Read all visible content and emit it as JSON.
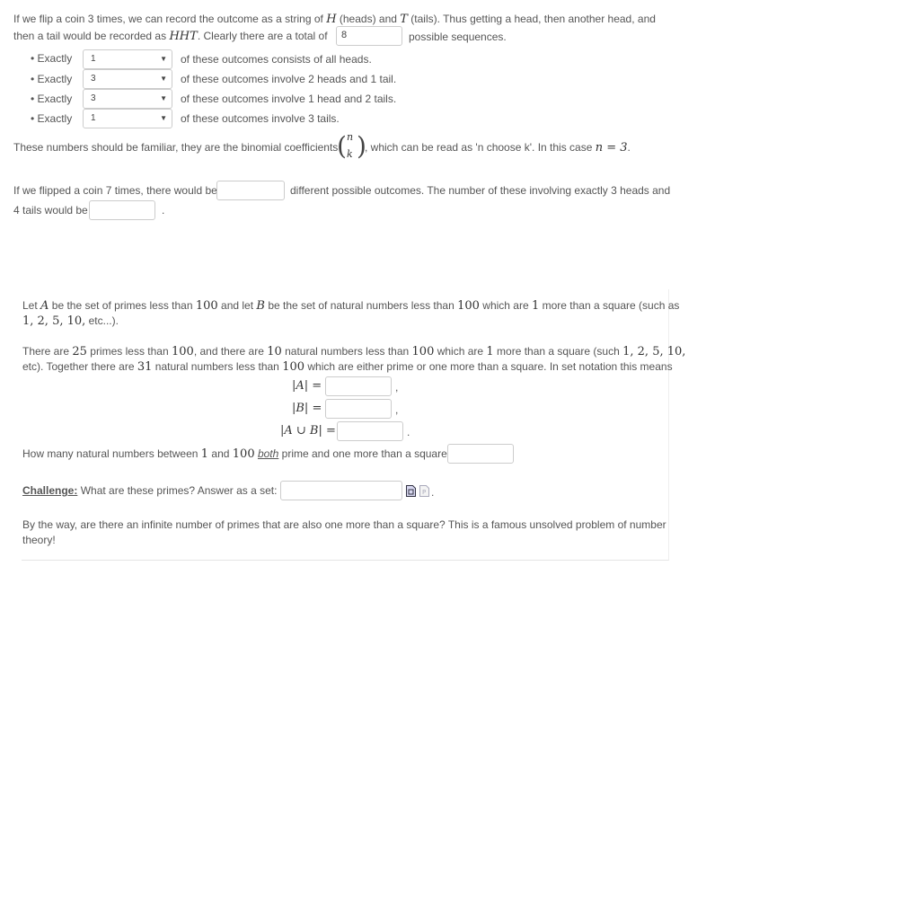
{
  "part1": {
    "p1_line1_a": "If we flip a coin 3 times, we can record the outcome as a string of",
    "var_H": "H",
    "p1_line1_b": "(heads) and",
    "var_T": "T",
    "p1_line1_c": "(tails). Thus getting a head, then another head, and",
    "p1_line2_a": "then a tail would be recorded as",
    "var_HHT": "HHT",
    "p1_line2_b": ". Clearly there are a total of",
    "total_value": "8",
    "p1_line2_c": "possible sequences.",
    "bullets": [
      {
        "prefix": "Exactly",
        "value": "1",
        "suffix": "of these outcomes consists of all heads."
      },
      {
        "prefix": "Exactly",
        "value": "3",
        "suffix": "of these outcomes involve 2 heads and 1 tail."
      },
      {
        "prefix": "Exactly",
        "value": "3",
        "suffix": "of these outcomes involve 1 head and 2 tails."
      },
      {
        "prefix": "Exactly",
        "value": "1",
        "suffix": "of these outcomes involve 3 tails."
      }
    ],
    "binom_a": "These numbers should be familiar, they are the binomial coefficients",
    "binom_n": "n",
    "binom_k": "k",
    "binom_b": ", which can be read as 'n choose k'. In this case",
    "binom_eq": "n = 3",
    "binom_end": ".",
    "q2_a": "If we flipped a coin 7 times, there would be",
    "q2_b": "different possible outcomes. The number of these involving exactly 3 heads and",
    "q2_c": "4 tails would be",
    "q2_end": ".",
    "q2_input1_value": "",
    "q2_input2_value": ""
  },
  "part2": {
    "l1_a": "Let",
    "A": "A",
    "l1_b": "be the set of primes less than",
    "n100": "100",
    "l1_c": "and let",
    "B": "B",
    "l1_d": "be the set of natural numbers less than",
    "l1_e": "which are",
    "n1": "1",
    "l1_f": "more than a square (such as",
    "l2_math": "1, 2, 5, 10,",
    "l2_text": "etc...).",
    "p2_a": "There are",
    "n25": "25",
    "p2_b": "primes less than",
    "p2_c": ", and there are",
    "n10": "10",
    "p2_d": "natural numbers less than",
    "p2_e": "which are",
    "p2_f": "more than a square (such",
    "p2_g": "1, 2, 5, 10,",
    "p2_h": "etc). Together there are",
    "n31": "31",
    "p2_i": "natural numbers less than",
    "p2_j": "which are either prime or one more than a square. In set notation this means",
    "eq_A": "|A| =",
    "eq_B": "|B| =",
    "eq_AUB": "|A ∪ B| =",
    "comma": ",",
    "period": ".",
    "q_both_a": "How many natural numbers between",
    "q_both_b": "and",
    "q_both_em": "both",
    "q_both_c": "prime and one more than a square?",
    "challenge_label": "Challenge:",
    "challenge_text": "What are these primes? Answer as a set:",
    "closing": "By the way, are there an infinite number of primes that are also one more than a square? This is a famous unsolved problem of number",
    "closing2": "theory!"
  }
}
